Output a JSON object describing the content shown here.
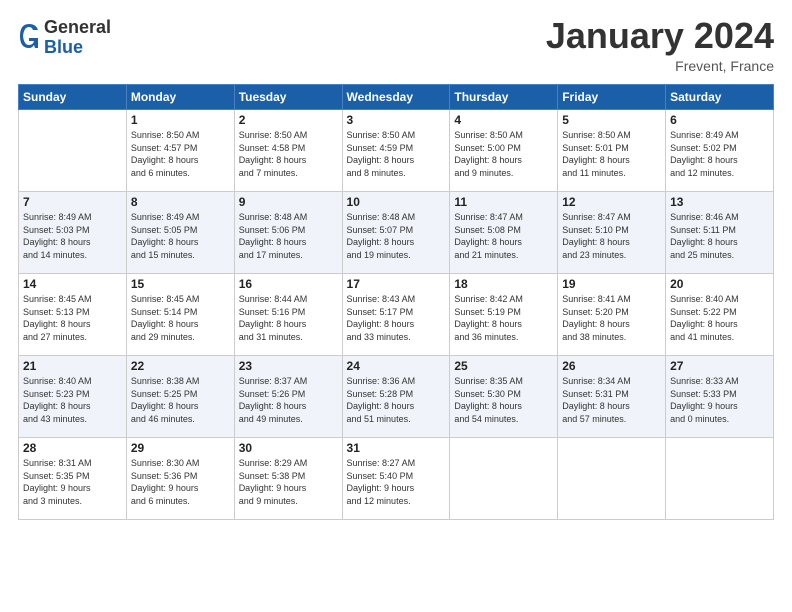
{
  "header": {
    "logo": {
      "general": "General",
      "blue": "Blue"
    },
    "month_title": "January 2024",
    "location": "Frevent, France"
  },
  "calendar": {
    "days_of_week": [
      "Sunday",
      "Monday",
      "Tuesday",
      "Wednesday",
      "Thursday",
      "Friday",
      "Saturday"
    ],
    "weeks": [
      [
        {
          "day": "",
          "sunrise": "",
          "sunset": "",
          "daylight": "",
          "daylight2": ""
        },
        {
          "day": "1",
          "sunrise": "Sunrise: 8:50 AM",
          "sunset": "Sunset: 4:57 PM",
          "daylight": "Daylight: 8 hours",
          "daylight2": "and 6 minutes."
        },
        {
          "day": "2",
          "sunrise": "Sunrise: 8:50 AM",
          "sunset": "Sunset: 4:58 PM",
          "daylight": "Daylight: 8 hours",
          "daylight2": "and 7 minutes."
        },
        {
          "day": "3",
          "sunrise": "Sunrise: 8:50 AM",
          "sunset": "Sunset: 4:59 PM",
          "daylight": "Daylight: 8 hours",
          "daylight2": "and 8 minutes."
        },
        {
          "day": "4",
          "sunrise": "Sunrise: 8:50 AM",
          "sunset": "Sunset: 5:00 PM",
          "daylight": "Daylight: 8 hours",
          "daylight2": "and 9 minutes."
        },
        {
          "day": "5",
          "sunrise": "Sunrise: 8:50 AM",
          "sunset": "Sunset: 5:01 PM",
          "daylight": "Daylight: 8 hours",
          "daylight2": "and 11 minutes."
        },
        {
          "day": "6",
          "sunrise": "Sunrise: 8:49 AM",
          "sunset": "Sunset: 5:02 PM",
          "daylight": "Daylight: 8 hours",
          "daylight2": "and 12 minutes."
        }
      ],
      [
        {
          "day": "7",
          "sunrise": "Sunrise: 8:49 AM",
          "sunset": "Sunset: 5:03 PM",
          "daylight": "Daylight: 8 hours",
          "daylight2": "and 14 minutes."
        },
        {
          "day": "8",
          "sunrise": "Sunrise: 8:49 AM",
          "sunset": "Sunset: 5:05 PM",
          "daylight": "Daylight: 8 hours",
          "daylight2": "and 15 minutes."
        },
        {
          "day": "9",
          "sunrise": "Sunrise: 8:48 AM",
          "sunset": "Sunset: 5:06 PM",
          "daylight": "Daylight: 8 hours",
          "daylight2": "and 17 minutes."
        },
        {
          "day": "10",
          "sunrise": "Sunrise: 8:48 AM",
          "sunset": "Sunset: 5:07 PM",
          "daylight": "Daylight: 8 hours",
          "daylight2": "and 19 minutes."
        },
        {
          "day": "11",
          "sunrise": "Sunrise: 8:47 AM",
          "sunset": "Sunset: 5:08 PM",
          "daylight": "Daylight: 8 hours",
          "daylight2": "and 21 minutes."
        },
        {
          "day": "12",
          "sunrise": "Sunrise: 8:47 AM",
          "sunset": "Sunset: 5:10 PM",
          "daylight": "Daylight: 8 hours",
          "daylight2": "and 23 minutes."
        },
        {
          "day": "13",
          "sunrise": "Sunrise: 8:46 AM",
          "sunset": "Sunset: 5:11 PM",
          "daylight": "Daylight: 8 hours",
          "daylight2": "and 25 minutes."
        }
      ],
      [
        {
          "day": "14",
          "sunrise": "Sunrise: 8:45 AM",
          "sunset": "Sunset: 5:13 PM",
          "daylight": "Daylight: 8 hours",
          "daylight2": "and 27 minutes."
        },
        {
          "day": "15",
          "sunrise": "Sunrise: 8:45 AM",
          "sunset": "Sunset: 5:14 PM",
          "daylight": "Daylight: 8 hours",
          "daylight2": "and 29 minutes."
        },
        {
          "day": "16",
          "sunrise": "Sunrise: 8:44 AM",
          "sunset": "Sunset: 5:16 PM",
          "daylight": "Daylight: 8 hours",
          "daylight2": "and 31 minutes."
        },
        {
          "day": "17",
          "sunrise": "Sunrise: 8:43 AM",
          "sunset": "Sunset: 5:17 PM",
          "daylight": "Daylight: 8 hours",
          "daylight2": "and 33 minutes."
        },
        {
          "day": "18",
          "sunrise": "Sunrise: 8:42 AM",
          "sunset": "Sunset: 5:19 PM",
          "daylight": "Daylight: 8 hours",
          "daylight2": "and 36 minutes."
        },
        {
          "day": "19",
          "sunrise": "Sunrise: 8:41 AM",
          "sunset": "Sunset: 5:20 PM",
          "daylight": "Daylight: 8 hours",
          "daylight2": "and 38 minutes."
        },
        {
          "day": "20",
          "sunrise": "Sunrise: 8:40 AM",
          "sunset": "Sunset: 5:22 PM",
          "daylight": "Daylight: 8 hours",
          "daylight2": "and 41 minutes."
        }
      ],
      [
        {
          "day": "21",
          "sunrise": "Sunrise: 8:40 AM",
          "sunset": "Sunset: 5:23 PM",
          "daylight": "Daylight: 8 hours",
          "daylight2": "and 43 minutes."
        },
        {
          "day": "22",
          "sunrise": "Sunrise: 8:38 AM",
          "sunset": "Sunset: 5:25 PM",
          "daylight": "Daylight: 8 hours",
          "daylight2": "and 46 minutes."
        },
        {
          "day": "23",
          "sunrise": "Sunrise: 8:37 AM",
          "sunset": "Sunset: 5:26 PM",
          "daylight": "Daylight: 8 hours",
          "daylight2": "and 49 minutes."
        },
        {
          "day": "24",
          "sunrise": "Sunrise: 8:36 AM",
          "sunset": "Sunset: 5:28 PM",
          "daylight": "Daylight: 8 hours",
          "daylight2": "and 51 minutes."
        },
        {
          "day": "25",
          "sunrise": "Sunrise: 8:35 AM",
          "sunset": "Sunset: 5:30 PM",
          "daylight": "Daylight: 8 hours",
          "daylight2": "and 54 minutes."
        },
        {
          "day": "26",
          "sunrise": "Sunrise: 8:34 AM",
          "sunset": "Sunset: 5:31 PM",
          "daylight": "Daylight: 8 hours",
          "daylight2": "and 57 minutes."
        },
        {
          "day": "27",
          "sunrise": "Sunrise: 8:33 AM",
          "sunset": "Sunset: 5:33 PM",
          "daylight": "Daylight: 9 hours",
          "daylight2": "and 0 minutes."
        }
      ],
      [
        {
          "day": "28",
          "sunrise": "Sunrise: 8:31 AM",
          "sunset": "Sunset: 5:35 PM",
          "daylight": "Daylight: 9 hours",
          "daylight2": "and 3 minutes."
        },
        {
          "day": "29",
          "sunrise": "Sunrise: 8:30 AM",
          "sunset": "Sunset: 5:36 PM",
          "daylight": "Daylight: 9 hours",
          "daylight2": "and 6 minutes."
        },
        {
          "day": "30",
          "sunrise": "Sunrise: 8:29 AM",
          "sunset": "Sunset: 5:38 PM",
          "daylight": "Daylight: 9 hours",
          "daylight2": "and 9 minutes."
        },
        {
          "day": "31",
          "sunrise": "Sunrise: 8:27 AM",
          "sunset": "Sunset: 5:40 PM",
          "daylight": "Daylight: 9 hours",
          "daylight2": "and 12 minutes."
        },
        {
          "day": "",
          "sunrise": "",
          "sunset": "",
          "daylight": "",
          "daylight2": ""
        },
        {
          "day": "",
          "sunrise": "",
          "sunset": "",
          "daylight": "",
          "daylight2": ""
        },
        {
          "day": "",
          "sunrise": "",
          "sunset": "",
          "daylight": "",
          "daylight2": ""
        }
      ]
    ]
  }
}
